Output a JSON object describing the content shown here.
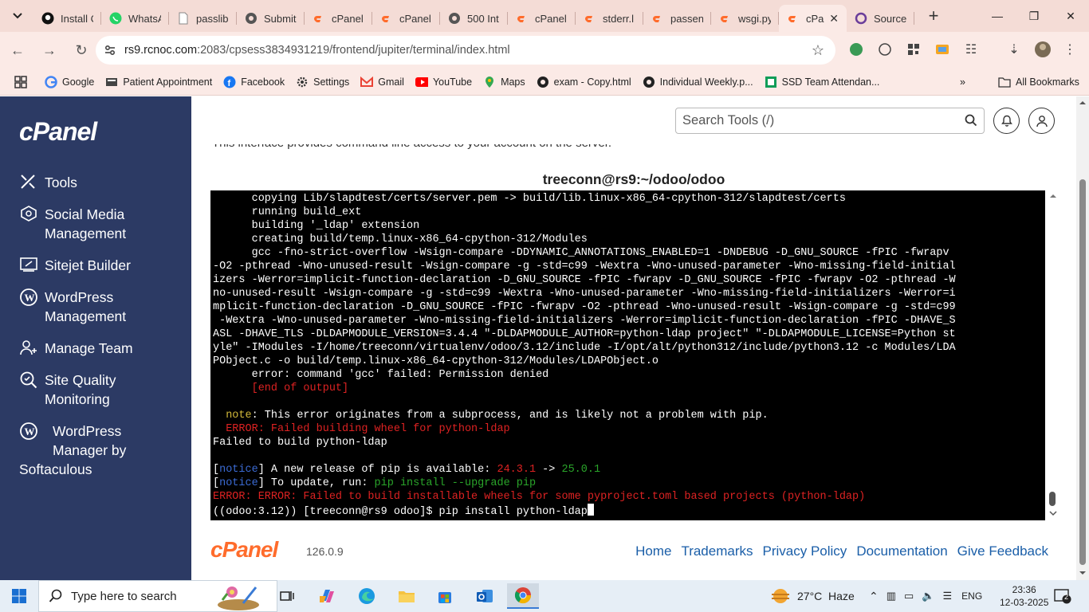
{
  "browser": {
    "tabs": [
      {
        "title": "Install C",
        "icon": "github-icon"
      },
      {
        "title": "WhatsA",
        "icon": "whatsapp-icon"
      },
      {
        "title": "passlib",
        "icon": "document-icon"
      },
      {
        "title": "Submit",
        "icon": "globe-icon"
      },
      {
        "title": "cPanel",
        "icon": "cpanel-icon"
      },
      {
        "title": "cPanel",
        "icon": "cpanel-icon"
      },
      {
        "title": "500 Int",
        "icon": "globe-icon"
      },
      {
        "title": "cPanel",
        "icon": "cpanel-icon"
      },
      {
        "title": "stderr.l",
        "icon": "cpanel-icon"
      },
      {
        "title": "passen",
        "icon": "cpanel-icon"
      },
      {
        "title": "wsgi.py",
        "icon": "cpanel-icon"
      },
      {
        "title": "cPa",
        "icon": "cpanel-icon",
        "active": true
      },
      {
        "title": "Source",
        "icon": "circle-icon"
      }
    ],
    "url_host": "rs9.rcnoc.com",
    "url_rest": ":2083/cpsess3834931219/frontend/jupiter/terminal/index.html",
    "bookmarks": [
      "Google",
      "Patient Appointment",
      "Facebook",
      "Settings",
      "Gmail",
      "YouTube",
      "Maps",
      "exam - Copy.html",
      "Individual Weekly.p...",
      "SSD Team Attendan..."
    ],
    "all_bookmarks": "All Bookmarks"
  },
  "cpanel": {
    "brand": "cPanel",
    "nav": [
      {
        "label_lines": [
          "Tools"
        ],
        "icon": "tools-icon"
      },
      {
        "label_lines": [
          "Social Media",
          "Management"
        ],
        "icon": "social-media-icon"
      },
      {
        "label_lines": [
          "Sitejet Builder"
        ],
        "icon": "sitejet-icon"
      },
      {
        "label_lines": [
          "WordPress",
          "Management"
        ],
        "icon": "wordpress-icon"
      },
      {
        "label_lines": [
          "Manage Team"
        ],
        "icon": "team-icon"
      },
      {
        "label_lines": [
          "Site Quality",
          "Monitoring"
        ],
        "icon": "site-quality-icon"
      },
      {
        "label_lines": [
          "WordPress",
          "Manager by",
          "Softaculous"
        ],
        "icon": "wordpress-icon"
      }
    ],
    "search_placeholder": "Search Tools (/)",
    "intro_text": "This interface provides command line access to your account on the server.",
    "terminal_title": "treeconn@rs9:~/odoo/odoo",
    "terminal_lines": [
      [
        {
          "t": "      copying Lib/slapdtest/certs/server.pem -> build/lib.linux-x86_64-cpython-312/slapdtest/certs"
        }
      ],
      [
        {
          "t": "      running build_ext"
        }
      ],
      [
        {
          "t": "      building '_ldap' extension"
        }
      ],
      [
        {
          "t": "      creating build/temp.linux-x86_64-cpython-312/Modules"
        }
      ],
      [
        {
          "t": "      gcc -fno-strict-overflow -Wsign-compare -DDYNAMIC_ANNOTATIONS_ENABLED=1 -DNDEBUG -D_GNU_SOURCE -fPIC -fwrapv"
        }
      ],
      [
        {
          "t": "-O2 -pthread -Wno-unused-result -Wsign-compare -g -std=c99 -Wextra -Wno-unused-parameter -Wno-missing-field-initial"
        }
      ],
      [
        {
          "t": "izers -Werror=implicit-function-declaration -D_GNU_SOURCE -fPIC -fwrapv -D_GNU_SOURCE -fPIC -fwrapv -O2 -pthread -W"
        }
      ],
      [
        {
          "t": "no-unused-result -Wsign-compare -g -std=c99 -Wextra -Wno-unused-parameter -Wno-missing-field-initializers -Werror=i"
        }
      ],
      [
        {
          "t": "mplicit-function-declaration -D_GNU_SOURCE -fPIC -fwrapv -O2 -pthread -Wno-unused-result -Wsign-compare -g -std=c99"
        }
      ],
      [
        {
          "t": " -Wextra -Wno-unused-parameter -Wno-missing-field-initializers -Werror=implicit-function-declaration -fPIC -DHAVE_S"
        }
      ],
      [
        {
          "t": "ASL -DHAVE_TLS -DLDAPMODULE_VERSION=3.4.4 \"-DLDAPMODULE_AUTHOR=python-ldap project\" \"-DLDAPMODULE_LICENSE=Python st"
        }
      ],
      [
        {
          "t": "yle\" -IModules -I/home/treeconn/virtualenv/odoo/3.12/include -I/opt/alt/python312/include/python3.12 -c Modules/LDA"
        }
      ],
      [
        {
          "t": "PObject.c -o build/temp.linux-x86_64-cpython-312/Modules/LDAPObject.o"
        }
      ],
      [
        {
          "t": "      error: command 'gcc' failed: Permission denied"
        }
      ],
      [
        {
          "t": "      "
        },
        {
          "t": "[end of output]",
          "c": "red"
        }
      ],
      [
        {
          "t": ""
        }
      ],
      [
        {
          "t": "  "
        },
        {
          "t": "note",
          "c": "yel"
        },
        {
          "t": ": This error originates from a subprocess, and is likely not a problem with pip."
        }
      ],
      [
        {
          "t": "  "
        },
        {
          "t": "ERROR: Failed building wheel for python-ldap",
          "c": "red"
        }
      ],
      [
        {
          "t": "Failed to build python-ldap"
        }
      ],
      [
        {
          "t": ""
        }
      ],
      [
        {
          "t": "["
        },
        {
          "t": "notice",
          "c": "blue"
        },
        {
          "t": "] A new release of pip is available: "
        },
        {
          "t": "24.3.1",
          "c": "red"
        },
        {
          "t": " -> "
        },
        {
          "t": "25.0.1",
          "c": "grn"
        }
      ],
      [
        {
          "t": "["
        },
        {
          "t": "notice",
          "c": "blue"
        },
        {
          "t": "] To update, run: "
        },
        {
          "t": "pip install --upgrade pip",
          "c": "grn"
        }
      ],
      [
        {
          "t": "ERROR: ERROR: Failed to build installable wheels for some pyproject.toml based projects (python-ldap)",
          "c": "red"
        }
      ],
      [
        {
          "t": "((odoo:3.12)) [treeconn@rs9 odoo]$ pip install python-ldap"
        },
        {
          "cursor": true
        }
      ]
    ],
    "footer_logo": "cPanel",
    "version": "126.0.9",
    "footer_links": [
      "Home",
      "Trademarks",
      "Privacy Policy",
      "Documentation",
      "Give Feedback"
    ]
  },
  "taskbar": {
    "search_placeholder": "Type here to search",
    "weather": "27°C  Haze",
    "language": "ENG",
    "time": "23:36",
    "date": "12-03-2025",
    "notifications": "2"
  }
}
